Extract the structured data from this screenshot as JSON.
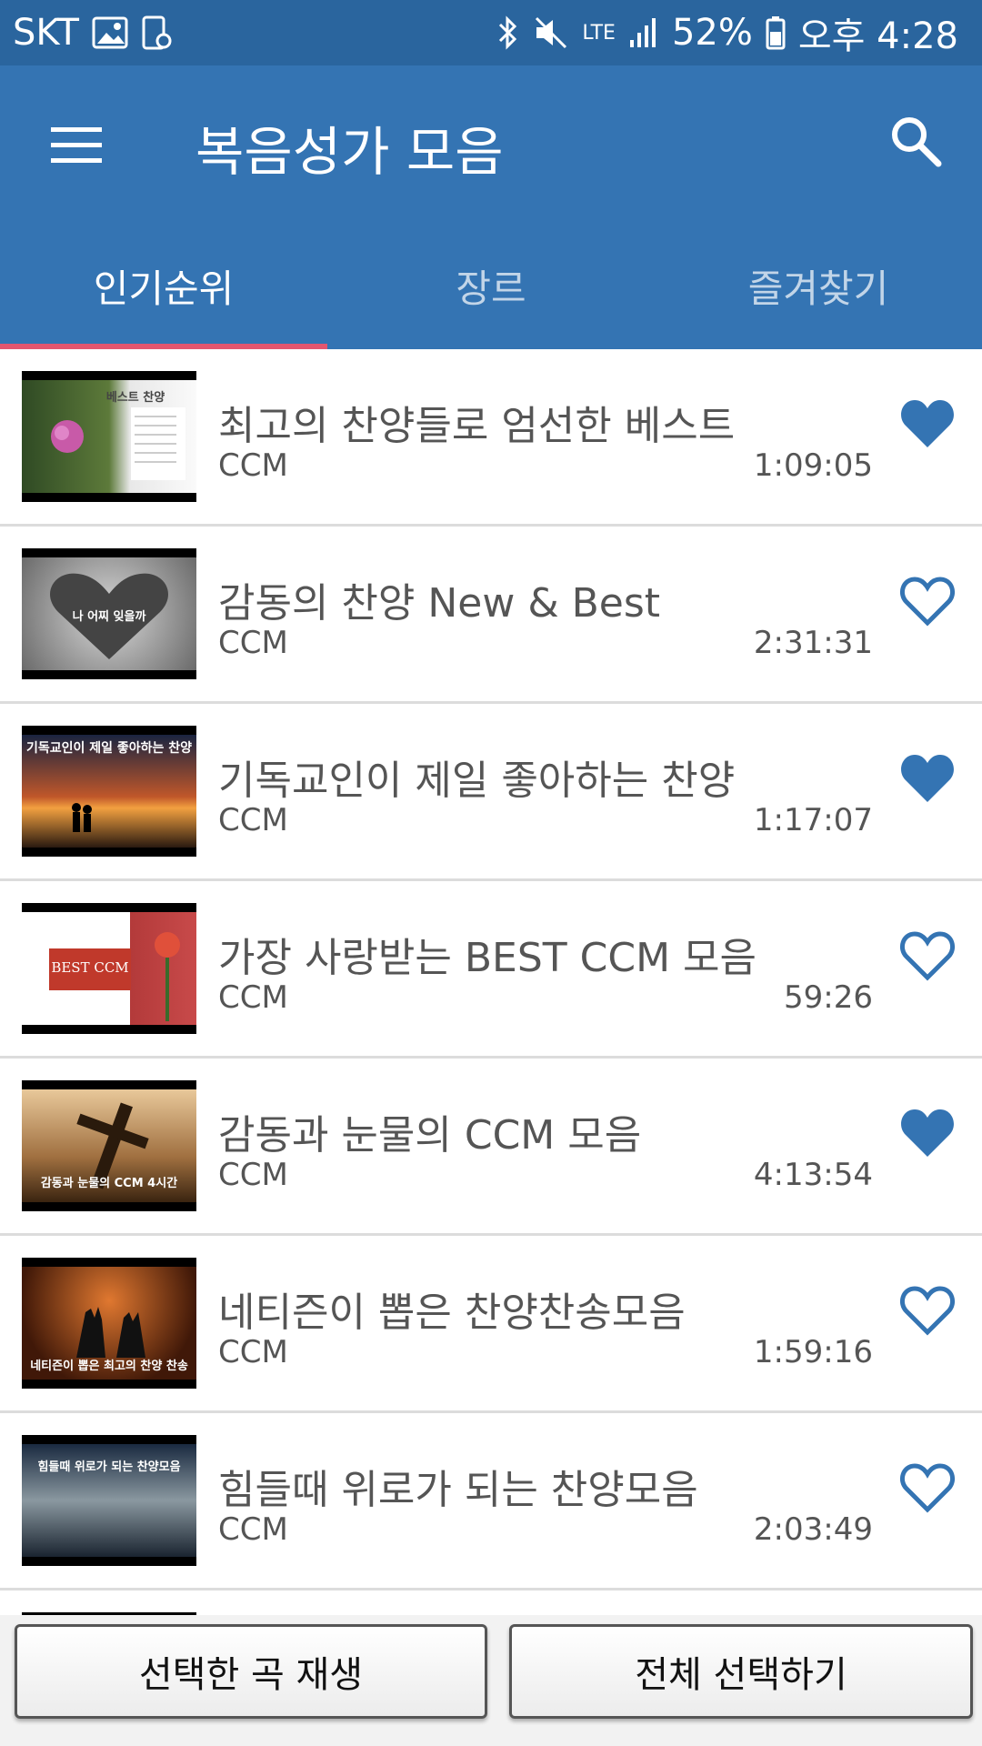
{
  "status_bar": {
    "carrier": "SKT",
    "battery": "52%",
    "time": "오후 4:28",
    "network": "LTE"
  },
  "appbar": {
    "title": "복음성가 모음"
  },
  "tabs": [
    {
      "label": "인기순위",
      "active": true
    },
    {
      "label": "장르",
      "active": false
    },
    {
      "label": "즐겨찾기",
      "active": false
    }
  ],
  "items": [
    {
      "title": "최고의 찬양들로 엄선한 베스트",
      "genre": "CCM",
      "duration": "1:09:05",
      "favorite": true,
      "thumb_text": "베스트 찬양"
    },
    {
      "title": "감동의 찬양 New & Best",
      "genre": "CCM",
      "duration": "2:31:31",
      "favorite": false,
      "thumb_text": "나 어찌 잊을까"
    },
    {
      "title": "기독교인이 제일 좋아하는 찬양",
      "genre": "CCM",
      "duration": "1:17:07",
      "favorite": true,
      "thumb_text": "기독교인이 제일 좋아하는 찬양"
    },
    {
      "title": "가장 사랑받는 BEST CCM 모음",
      "genre": "CCM",
      "duration": "59:26",
      "favorite": false,
      "thumb_text": "BEST CCM"
    },
    {
      "title": "감동과 눈물의 CCM 모음",
      "genre": "CCM",
      "duration": "4:13:54",
      "favorite": true,
      "thumb_text": "감동과 눈물의 CCM 4시간"
    },
    {
      "title": "네티즌이 뽑은 찬양찬송모음",
      "genre": "CCM",
      "duration": "1:59:16",
      "favorite": false,
      "thumb_text": "네티즌이 뽑은 최고의 찬양 찬송"
    },
    {
      "title": "힘들때 위로가 되는 찬양모음",
      "genre": "CCM",
      "duration": "2:03:49",
      "favorite": false,
      "thumb_text": "힘들때 위로가 되는 찬양모음"
    }
  ],
  "buttons": {
    "play_selected": "선택한 곡 재생",
    "select_all": "전체 선택하기"
  },
  "colors": {
    "primary": "#3474b3",
    "status_bar": "#2a659e",
    "tab_indicator": "#e4566f",
    "heart": "#3474b3"
  }
}
